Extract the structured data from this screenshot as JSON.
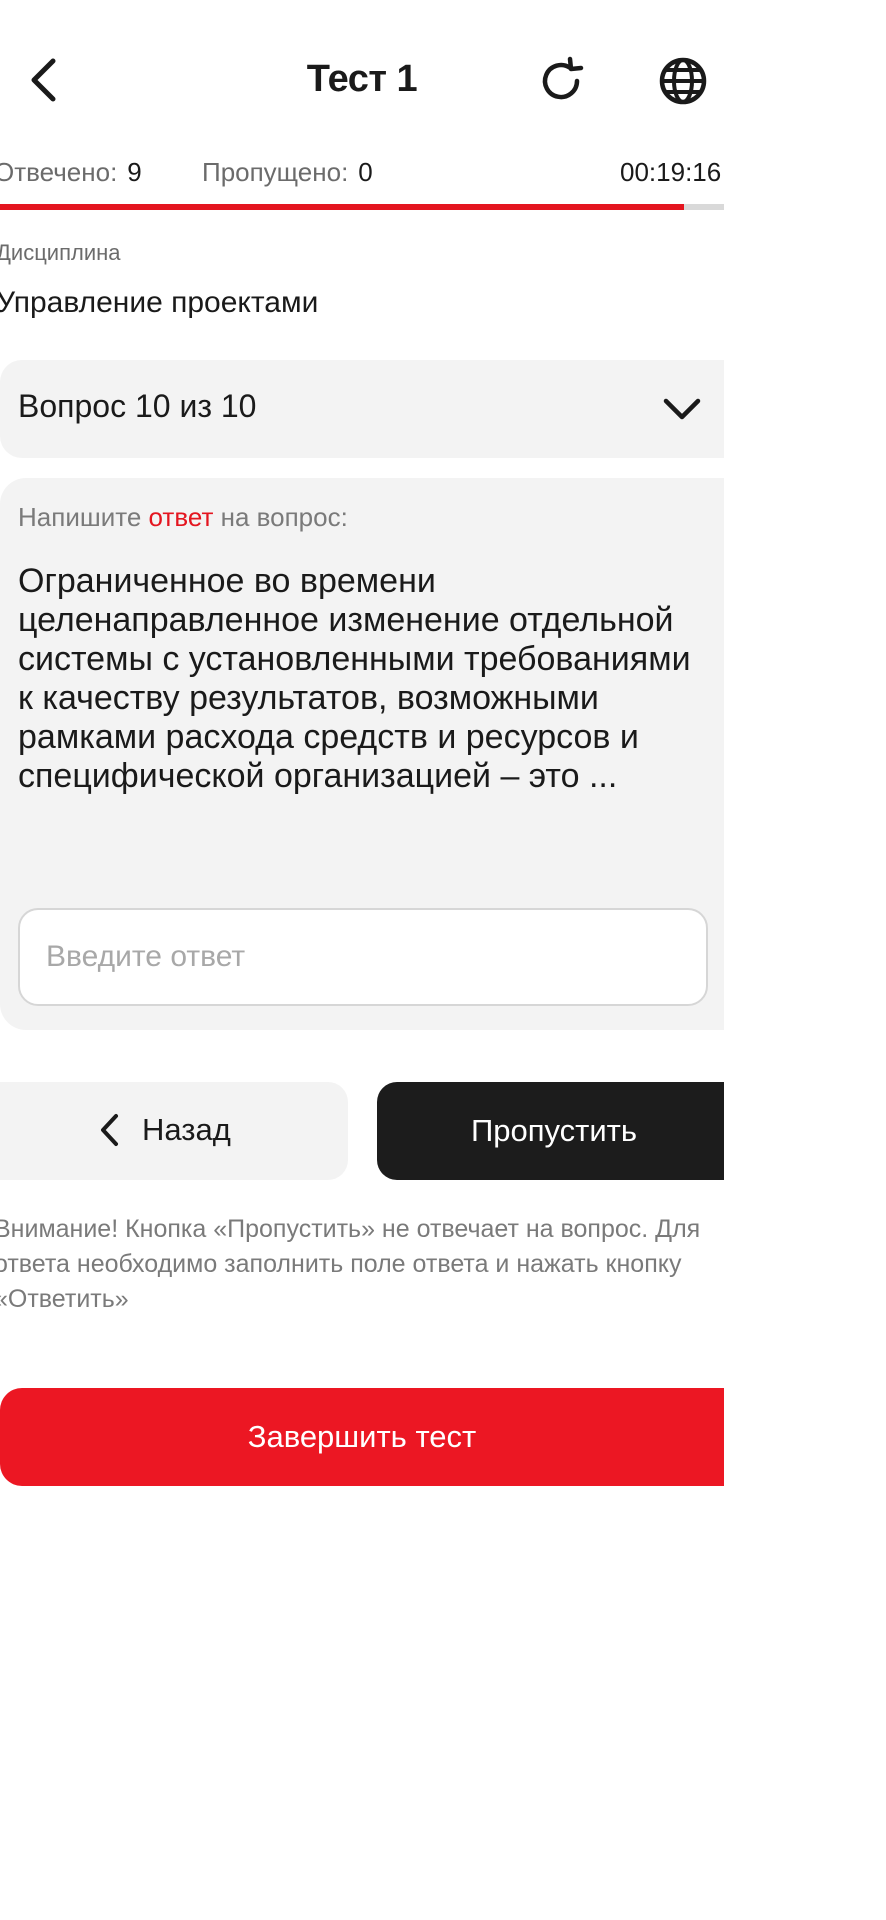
{
  "header": {
    "title": "Тест 1",
    "back_icon": "chevron-left-icon",
    "refresh_icon": "refresh-icon",
    "language_icon": "globe-icon"
  },
  "stats": {
    "answered_label": "Отвечено:",
    "answered_value": "9",
    "skipped_label": "Пропущено:",
    "skipped_value": "0",
    "timer": "00:19:16"
  },
  "progress": {
    "fraction": 0.945,
    "color": "#e4151f"
  },
  "discipline": {
    "label": "Дисциплина",
    "value": "Управление проектами"
  },
  "question_selector": {
    "label": "Вопрос 10 из 10",
    "icon": "chevron-down-icon"
  },
  "question": {
    "prompt_before": "Напишите ",
    "prompt_accent": "ответ",
    "prompt_after": " на вопрос:",
    "text": "Ограниченное во времени целенаправленное изменение отдельной системы с установленными требованиями к качеству результатов, возможными рамками расхода средств и ресурсов и специфической организацией – это ...",
    "answer_placeholder": "Введите ответ",
    "answer_value": ""
  },
  "actions": {
    "back_label": "Назад",
    "skip_label": "Пропустить"
  },
  "notice": "Внимание! Кнопка «Пропустить» не отвечает на вопрос. Для ответа необходимо заполнить поле ответа и нажать кнопку «Ответить»",
  "finish_label": "Завершить тест",
  "colors": {
    "accent": "#e4151f",
    "dark_button": "#1c1c1c",
    "card_bg": "#f3f3f3"
  }
}
